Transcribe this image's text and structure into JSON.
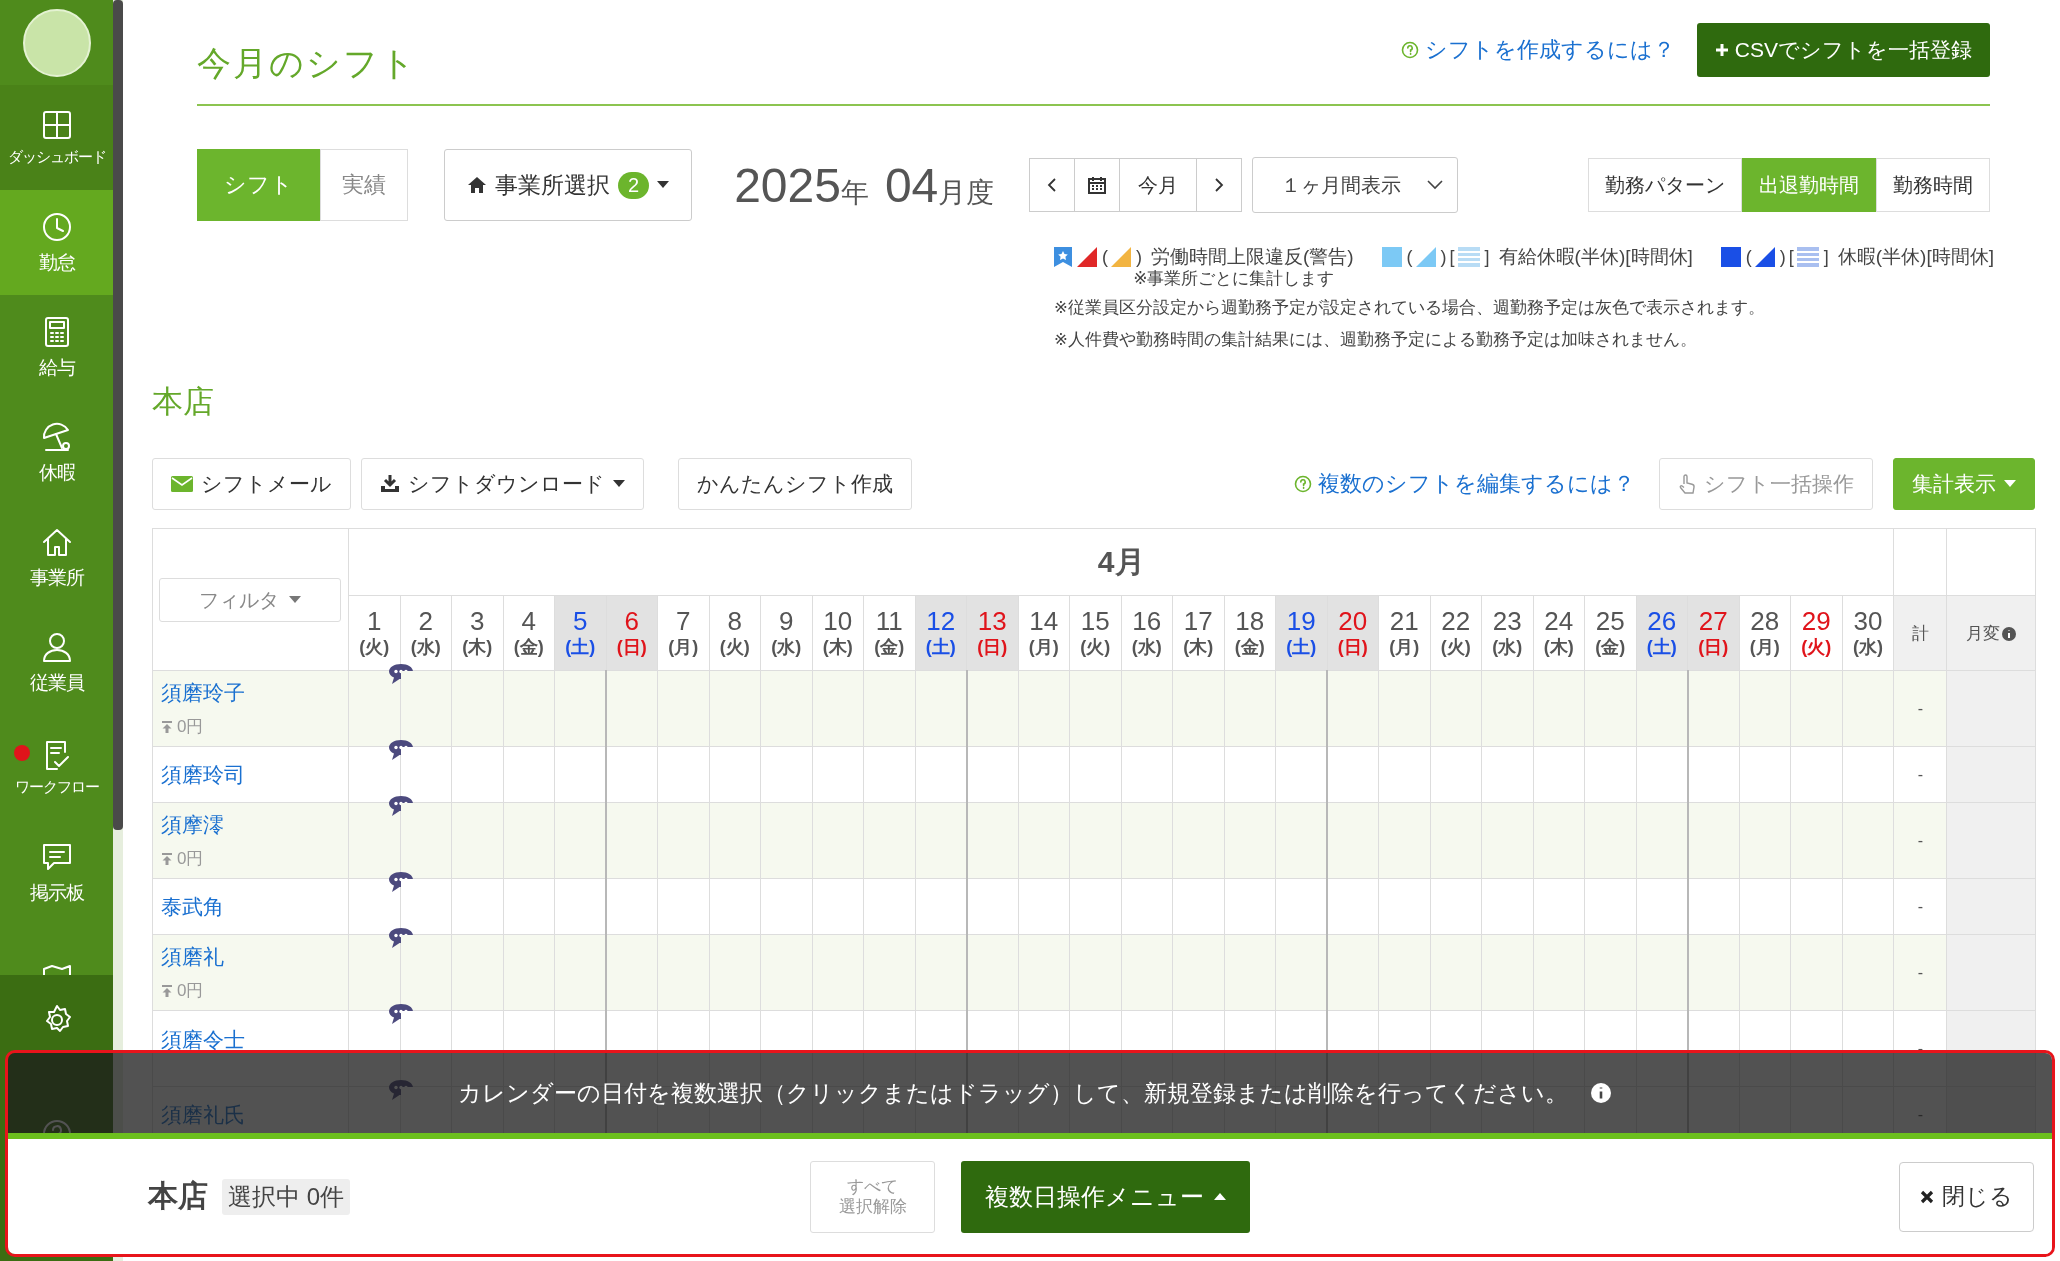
{
  "sidebar": {
    "items": [
      {
        "kind": "dashboard",
        "label": "ダッシュボード",
        "selected": false
      },
      {
        "kind": "clock",
        "label": "勤怠",
        "selected": true
      },
      {
        "kind": "calculator",
        "label": "給与",
        "selected": false
      },
      {
        "kind": "umbrella",
        "label": "休暇",
        "selected": false
      },
      {
        "kind": "house",
        "label": "事業所",
        "selected": false
      },
      {
        "kind": "person",
        "label": "従業員",
        "selected": false
      },
      {
        "kind": "checklist",
        "label": "ワークフロー",
        "selected": false,
        "alert": true
      },
      {
        "kind": "chat",
        "label": "掲示板",
        "selected": false
      },
      {
        "kind": "map",
        "selected": false
      }
    ],
    "footer_items": [
      {
        "kind": "settings"
      },
      {
        "kind": "help"
      }
    ]
  },
  "header": {
    "title": "今月のシフト",
    "help_link": "シフトを作成するには？",
    "csv_button": "CSVでシフトを一括登録"
  },
  "controls": {
    "mode_tabs": [
      {
        "label": "シフト",
        "selected": true
      },
      {
        "label": "実績",
        "selected": false
      }
    ],
    "office_select": {
      "label": "事業所選択",
      "count": "2"
    },
    "period": {
      "year": "2025",
      "year_unit": "年",
      "month": "04",
      "month_unit": "月度"
    },
    "today_button": "今月",
    "range_select": "１ヶ月間表示",
    "view_tabs": [
      {
        "label": "勤務パターン",
        "selected": false
      },
      {
        "label": "出退勤時間",
        "selected": true
      },
      {
        "label": "勤務時間",
        "selected": false
      }
    ]
  },
  "legend": [
    {
      "label": "労働時間上限違反(警告)",
      "note": "※事業所ごとに集計します",
      "marks": [
        {
          "kind": "badge",
          "color": "#3d8fe0"
        },
        {
          "kind": "triangle",
          "color": "#e02828"
        },
        {
          "kind": "triangle",
          "color": "#f2b441",
          "before": "(",
          "after": ")"
        }
      ]
    },
    {
      "label": "有給休暇(半休)[時間休]",
      "marks": [
        {
          "kind": "square",
          "color": "#7cc9f5"
        },
        {
          "kind": "triangle",
          "color": "#7cc9f5",
          "before": "(",
          "after": ")"
        },
        {
          "kind": "stripes",
          "color": "#b8dcf5",
          "before": "[",
          "after": "]"
        }
      ]
    },
    {
      "label": "休暇(半休)[時間休]",
      "marks": [
        {
          "kind": "square",
          "color": "#1a4fe6"
        },
        {
          "kind": "triangle",
          "color": "#1a4fe6",
          "before": "(",
          "after": ")"
        },
        {
          "kind": "stripes",
          "color": "#a9bff0",
          "before": "[",
          "after": "]"
        }
      ]
    }
  ],
  "notes": [
    "※従業員区分設定から週勤務予定が設定されている場合、週勤務予定は灰色で表示されます。",
    "※人件費や勤務時間の集計結果には、週勤務予定による勤務予定は加味されません。"
  ],
  "store": {
    "name": "本店"
  },
  "toolbar": {
    "mail_button": "シフトメール",
    "download_button": "シフトダウンロード",
    "easy_button": "かんたんシフト作成",
    "help_link": "複数のシフトを編集するには？",
    "bulk_button": {
      "label": "シフト一括操作",
      "disabled": true
    },
    "summary_button": "集計表示"
  },
  "table": {
    "filter": "フィルタ",
    "month": "4月",
    "total_header": "計",
    "monthly_change_header": "月変",
    "days": [
      {
        "day": "1",
        "weekday": "(火)",
        "kind": "weekday"
      },
      {
        "day": "2",
        "weekday": "(水)",
        "kind": "weekday"
      },
      {
        "day": "3",
        "weekday": "(木)",
        "kind": "weekday"
      },
      {
        "day": "4",
        "weekday": "(金)",
        "kind": "weekday"
      },
      {
        "day": "5",
        "weekday": "(土)",
        "kind": "saturday"
      },
      {
        "day": "6",
        "weekday": "(日)",
        "kind": "sunday"
      },
      {
        "day": "7",
        "weekday": "(月)",
        "kind": "weekday"
      },
      {
        "day": "8",
        "weekday": "(火)",
        "kind": "weekday"
      },
      {
        "day": "9",
        "weekday": "(水)",
        "kind": "weekday"
      },
      {
        "day": "10",
        "weekday": "(木)",
        "kind": "weekday"
      },
      {
        "day": "11",
        "weekday": "(金)",
        "kind": "weekday"
      },
      {
        "day": "12",
        "weekday": "(土)",
        "kind": "saturday"
      },
      {
        "day": "13",
        "weekday": "(日)",
        "kind": "sunday"
      },
      {
        "day": "14",
        "weekday": "(月)",
        "kind": "weekday"
      },
      {
        "day": "15",
        "weekday": "(火)",
        "kind": "weekday"
      },
      {
        "day": "16",
        "weekday": "(水)",
        "kind": "weekday"
      },
      {
        "day": "17",
        "weekday": "(木)",
        "kind": "weekday"
      },
      {
        "day": "18",
        "weekday": "(金)",
        "kind": "weekday"
      },
      {
        "day": "19",
        "weekday": "(土)",
        "kind": "saturday"
      },
      {
        "day": "20",
        "weekday": "(日)",
        "kind": "sunday"
      },
      {
        "day": "21",
        "weekday": "(月)",
        "kind": "weekday"
      },
      {
        "day": "22",
        "weekday": "(火)",
        "kind": "weekday"
      },
      {
        "day": "23",
        "weekday": "(水)",
        "kind": "weekday"
      },
      {
        "day": "24",
        "weekday": "(木)",
        "kind": "weekday"
      },
      {
        "day": "25",
        "weekday": "(金)",
        "kind": "weekday"
      },
      {
        "day": "26",
        "weekday": "(土)",
        "kind": "saturday"
      },
      {
        "day": "27",
        "weekday": "(日)",
        "kind": "sunday"
      },
      {
        "day": "28",
        "weekday": "(月)",
        "kind": "weekday"
      },
      {
        "day": "29",
        "weekday": "(火)",
        "kind": "holiday"
      },
      {
        "day": "30",
        "weekday": "(水)",
        "kind": "weekday"
      }
    ],
    "rows": [
      {
        "name": "須磨玲子",
        "cost": "0円",
        "total": "-",
        "comment": true
      },
      {
        "name": "須磨玲司",
        "total": "-",
        "comment": true
      },
      {
        "name": "須摩澪",
        "cost": "0円",
        "total": "-",
        "comment": true
      },
      {
        "name": "泰武角",
        "total": "-",
        "comment": true
      },
      {
        "name": "須磨礼",
        "cost": "0円",
        "total": "-",
        "comment": true
      },
      {
        "name": "須磨令士",
        "total": "-",
        "comment": true,
        "tall": true
      },
      {
        "name": "須磨礼氏",
        "total": "-",
        "comment": true
      }
    ]
  },
  "bottom_panel": {
    "highlighted": true,
    "message": "カレンダーの日付を複数選択（クリックまたはドラッグ）して、新規登録または削除を行ってください。",
    "store": "本店",
    "selection": "選択中 0件",
    "clear_button": [
      "すべて",
      "選択解除"
    ],
    "menu_button": "複数日操作メニュー",
    "close_button": "閉じる"
  }
}
